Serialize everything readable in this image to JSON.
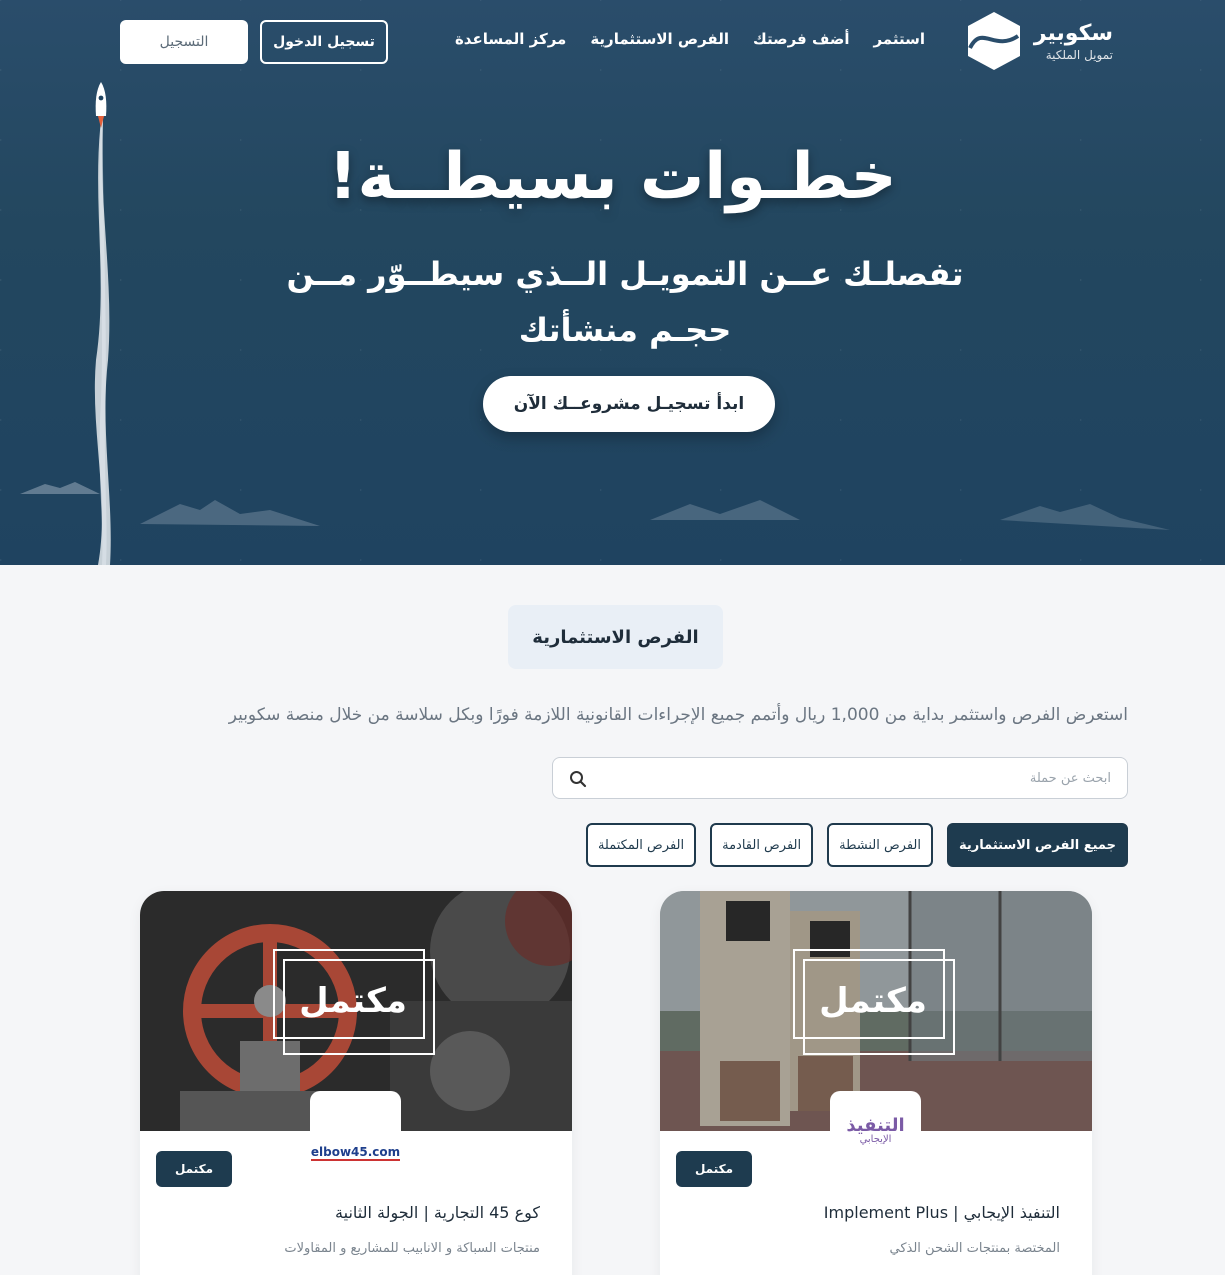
{
  "header": {
    "logo_name": "سكوبير",
    "logo_sub": "تمويل الملكية",
    "nav": [
      "استثمر",
      "أضف فرصتك",
      "الفرص الاستثمارية",
      "مركز المساعدة"
    ],
    "login_label": "تسجيل الدخول",
    "register_label": "التسجيل"
  },
  "hero": {
    "title": "خطـوات بسيطــة!",
    "subtitle": "تفصلـك عــن التمويـل الــذي سيطــوّر مــن حجـم منشأتك",
    "cta": "ابدأ تسجيـل مشروعــك الآن"
  },
  "section": {
    "tag": "الفرص الاستثمارية",
    "description": "استعرض الفرص واستثمر بداية من 1,000 ريال وأتمم جميع الإجراءات القانونية اللازمة فورًا وبكل سلاسة من خلال منصة سكوبير"
  },
  "search": {
    "placeholder": "ابحث عن حملة"
  },
  "filters": [
    "جميع الفرص الاستثمارية",
    "الفرص النشطة",
    "الفرص القادمة",
    "الفرص المكتملة"
  ],
  "cards": [
    {
      "overlay": "مكتمل",
      "logo_text": "التنفيذ",
      "logo_sub": "الإيجابي",
      "badge": "مكتمل",
      "title": "التنفيذ الإيجابي | Implement Plus",
      "desc": "المختصة بمنتجات الشحن الذكي"
    },
    {
      "overlay": "مكتمل",
      "logo_text": "elbow45.com",
      "badge": "مكتمل",
      "title": "كوع 45 التجارية | الجولة الثانية",
      "desc": "منتجات السباكة و الانابيب للمشاريع و المقاولات"
    }
  ],
  "colors": {
    "hero_bg": "#23475f",
    "primary": "#1e3b4f",
    "page_bg": "#f5f6f8"
  }
}
